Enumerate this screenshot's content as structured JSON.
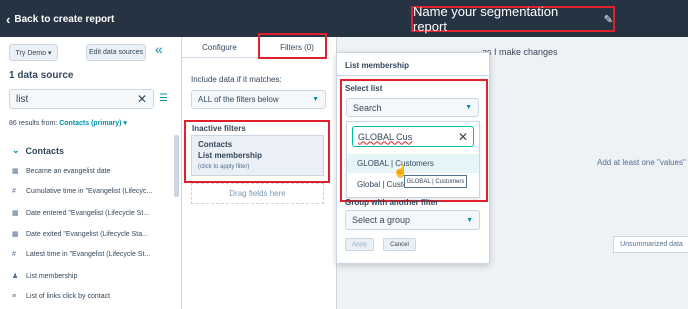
{
  "topbar": {
    "back_label": "Back to create report",
    "report_name": "Name your segmentation report"
  },
  "sidebar": {
    "try_demo": "Try Demo ▾",
    "edit_sources": "Edit data sources",
    "source_count": "1 data source",
    "search_value": "list",
    "results_prefix": "86 results from:",
    "results_object": "Contacts (primary) ▾",
    "group": "Contacts",
    "properties": [
      {
        "icon": "calendar-icon",
        "label": "Became an evangelist date"
      },
      {
        "icon": "number-icon",
        "label": "Cumulative time in \"Evangelist (Lifecyc..."
      },
      {
        "icon": "calendar-icon",
        "label": "Date entered \"Evangelist (Lifecycle St..."
      },
      {
        "icon": "calendar-icon",
        "label": "Date exited \"Evangelist (Lifecycle Sta..."
      },
      {
        "icon": "number-icon",
        "label": "Latest time in \"Evangelist (Lifecycle St..."
      },
      {
        "icon": "users-icon",
        "label": "List membership"
      },
      {
        "icon": "text-icon",
        "label": "List of links click by contact"
      }
    ]
  },
  "config_panel": {
    "tab_configure": "Configure",
    "tab_filters": "Filters (0)",
    "include_label": "Include data if it matches:",
    "include_value": "ALL of the filters below",
    "inactive_title": "Inactive filters",
    "card_line1": "Contacts",
    "card_line2": "List membership",
    "card_hint": "(click to apply filter)",
    "drag_hint": "Drag fields here"
  },
  "canvas": {
    "ghost_text": "as I make changes",
    "hint": "Add at least one \"values\" f",
    "unsummarized": "Unsummarized data"
  },
  "popover": {
    "title": "List membership",
    "select_label": "Select list",
    "select_placeholder": "Search",
    "search_value": "GLOBAL Cus",
    "option1": "GLOBAL | Customers",
    "option2": "Global | Custo",
    "tooltip": "GLOBAL | Customers",
    "group_label": "Group with another filter",
    "group_placeholder": "Select a group",
    "apply": "Apply",
    "cancel": "Cancel"
  },
  "colors": {
    "topbar": "#253342",
    "accent": "#0091ae",
    "highlight": "#e0202c",
    "focus": "#00bda5"
  }
}
